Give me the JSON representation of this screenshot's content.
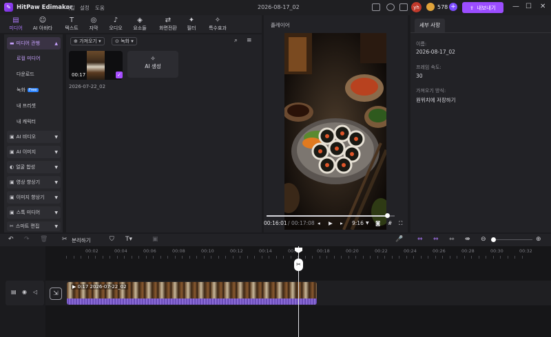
{
  "app": {
    "name": "HitPaw Edimakor",
    "menus": [
      "파일",
      "설정",
      "도움"
    ],
    "project_name": "2026-08-17_02",
    "avatar": "yh",
    "credits": "578",
    "export_label": "내보내기"
  },
  "toolbar": [
    {
      "icon": "folder-icon",
      "label": "미디어",
      "active": true
    },
    {
      "icon": "ai-icon",
      "label": "AI 아바타"
    },
    {
      "icon": "text-icon",
      "label": "텍스트"
    },
    {
      "icon": "subtitle-icon",
      "label": "자막"
    },
    {
      "icon": "audio-icon",
      "label": "오디오"
    },
    {
      "icon": "elements-icon",
      "label": "요소들"
    },
    {
      "icon": "transition-icon",
      "label": "화면전환"
    },
    {
      "icon": "filter-icon",
      "label": "필터"
    },
    {
      "icon": "effects-icon",
      "label": "특수효과"
    }
  ],
  "sidebar": {
    "items": [
      {
        "label": "미디어 관행",
        "type": "group-open"
      },
      {
        "label": "로컬 미디어",
        "type": "sub-selected"
      },
      {
        "label": "다운로드",
        "type": "sub"
      },
      {
        "label": "녹화",
        "type": "sub",
        "badge": "Free"
      },
      {
        "label": "내 프리셋",
        "type": "sub"
      },
      {
        "label": "내 캐릭터",
        "type": "sub"
      },
      {
        "label": "AI 비디오",
        "type": "group"
      },
      {
        "label": "AI 이미지",
        "type": "group"
      },
      {
        "label": "얼굴 합성",
        "type": "group"
      },
      {
        "label": "영상 향상기",
        "type": "group"
      },
      {
        "label": "이미지 향상기",
        "type": "group"
      },
      {
        "label": "스톡 미디어",
        "type": "group"
      },
      {
        "label": "스마트 편집",
        "type": "group"
      }
    ]
  },
  "media": {
    "import_label": "가져오기",
    "record_label": "녹화",
    "clip": {
      "duration": "00:17",
      "name": "2026-07-22_02"
    },
    "ai_generate_label": "AI 생성"
  },
  "player": {
    "title": "플레이어",
    "current_time": "00:16:01",
    "total_time": "00:17:08",
    "aspect": "9:16",
    "progress": 0.94
  },
  "details": {
    "tab_label": "세부 사항",
    "name_label": "이름:",
    "name_value": "2026-08-17_02",
    "framerate_label": "프레임 속도:",
    "framerate_value": "30",
    "import_label": "가져오기 방식:",
    "import_value": "원위치에 저장하기"
  },
  "timeline_toolbar": {
    "split_label": "분리하기"
  },
  "timeline": {
    "ticks": [
      "00:00",
      "00:02",
      "00:04",
      "00:06",
      "00:08",
      "00:10",
      "00:12",
      "00:14",
      "00:16",
      "00:18",
      "00:20",
      "00:22",
      "00:24",
      "00:26",
      "00:28",
      "00:30",
      "00:32"
    ],
    "clip_label": "0:17  2026-07-22_02"
  }
}
